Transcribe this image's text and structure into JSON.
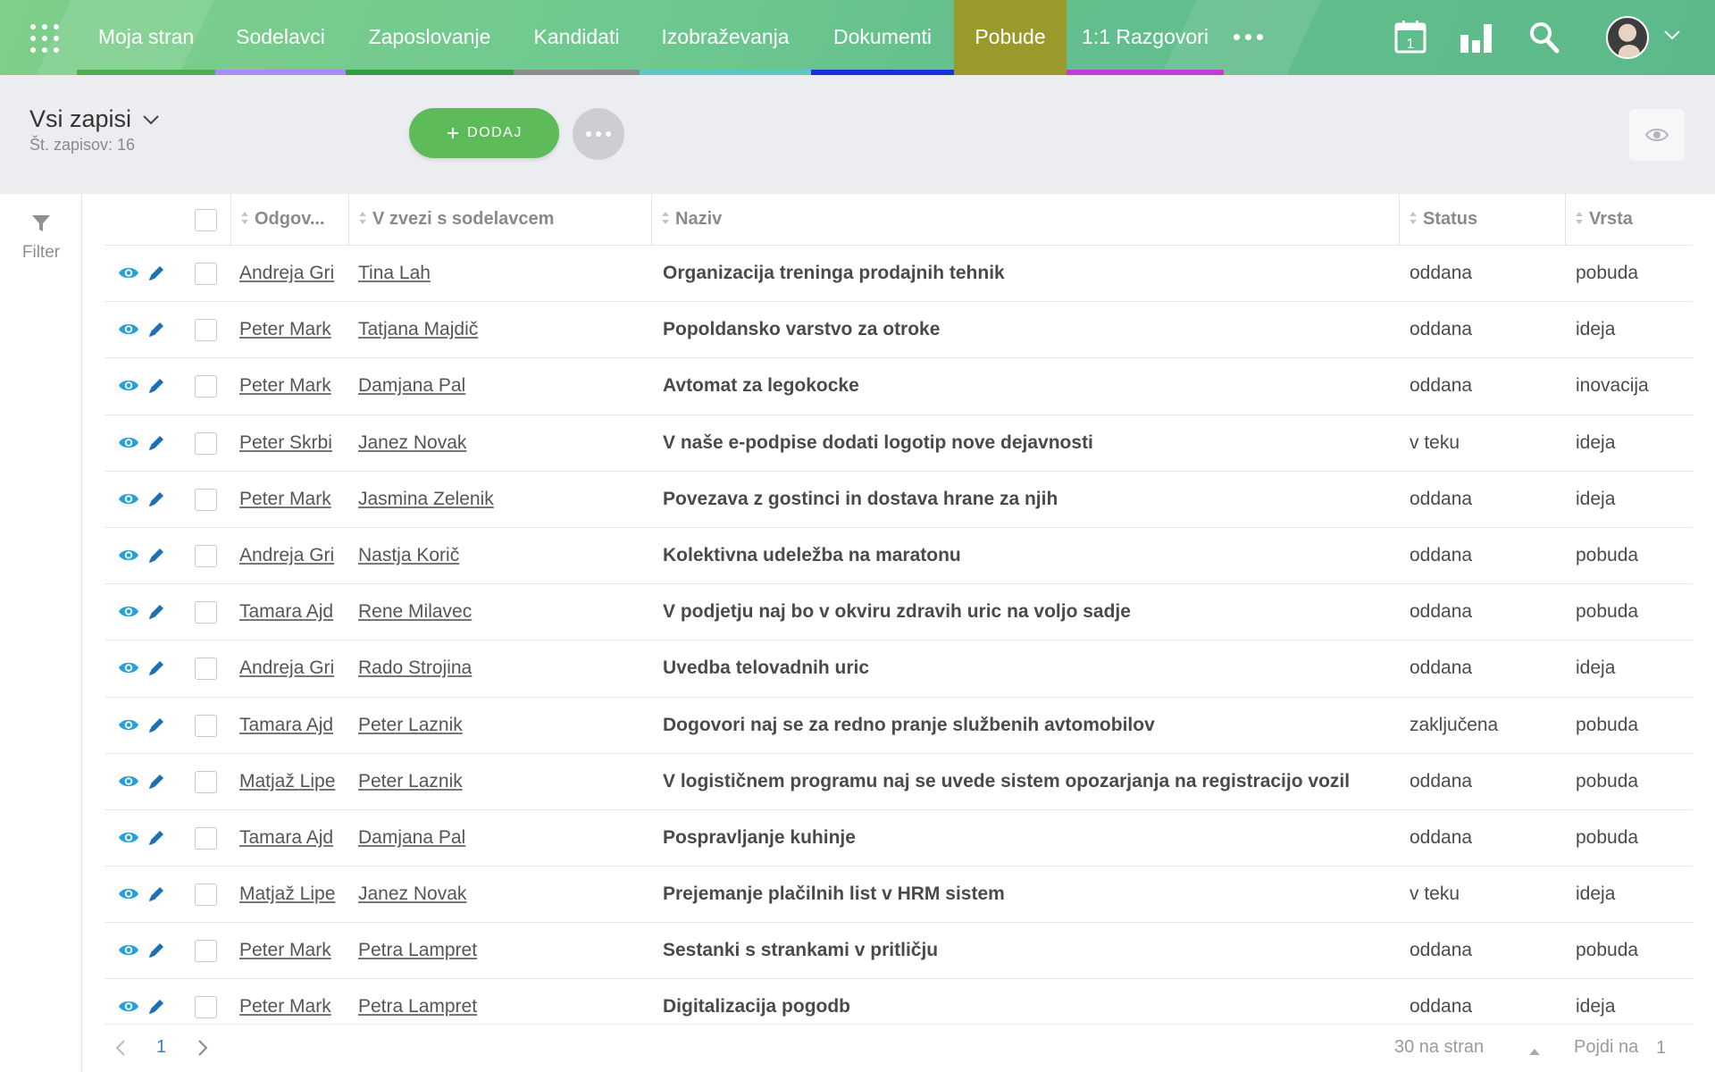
{
  "nav": {
    "items": [
      {
        "label": "Moja stran",
        "color": "#4caf50"
      },
      {
        "label": "Sodelavci",
        "color": "#a78bfa"
      },
      {
        "label": "Zaposlovanje",
        "color": "#2e9e3e"
      },
      {
        "label": "Kandidati",
        "color": "#8c8c8c"
      },
      {
        "label": "Izobraževanja",
        "color": "#5bc8c2"
      },
      {
        "label": "Dokumenti",
        "color": "#1a2fd6"
      },
      {
        "label": "Pobude",
        "color": "#9a9a2c"
      },
      {
        "label": "1:1 Razgovori",
        "color": "#c13bd6"
      }
    ],
    "active": "Pobude",
    "calendar_day": "1",
    "icons": [
      "apps-grid-icon",
      "more-dots-icon",
      "calendar-icon",
      "bar-chart-icon",
      "search-icon",
      "avatar",
      "chevron-down-icon"
    ]
  },
  "toolbar": {
    "view_title": "Vsi zapisi",
    "count_text": "Št. zapisov: 16",
    "add_label": "DODAJ"
  },
  "filter": {
    "label": "Filter"
  },
  "table": {
    "columns": [
      "Odgov...",
      "V zvezi s sodelavcem",
      "Naziv",
      "Status",
      "Vrsta"
    ],
    "rows": [
      {
        "odgovorni": "Andreja Gri",
        "sodelavec": "Tina Lah",
        "naziv": "Organizacija treninga prodajnih tehnik",
        "status": "oddana",
        "vrsta": "pobuda"
      },
      {
        "odgovorni": "Peter Mark",
        "sodelavec": "Tatjana Majdič",
        "naziv": "Popoldansko varstvo za otroke",
        "status": "oddana",
        "vrsta": "ideja"
      },
      {
        "odgovorni": "Peter Mark",
        "sodelavec": "Damjana Pal",
        "naziv": "Avtomat za legokocke",
        "status": "oddana",
        "vrsta": "inovacija"
      },
      {
        "odgovorni": "Peter Skrbi",
        "sodelavec": "Janez Novak",
        "naziv": "V naše e-podpise dodati logotip nove dejavnosti",
        "status": "v teku",
        "vrsta": "ideja"
      },
      {
        "odgovorni": "Peter Mark",
        "sodelavec": "Jasmina Zelenik",
        "naziv": "Povezava z gostinci in dostava hrane za njih",
        "status": "oddana",
        "vrsta": "ideja"
      },
      {
        "odgovorni": "Andreja Gri",
        "sodelavec": "Nastja Korič",
        "naziv": "Kolektivna udeležba na maratonu",
        "status": "oddana",
        "vrsta": "pobuda"
      },
      {
        "odgovorni": "Tamara Ajd",
        "sodelavec": "Rene Milavec",
        "naziv": "V podjetju naj bo v okviru zdravih uric na voljo sadje",
        "status": "oddana",
        "vrsta": "pobuda"
      },
      {
        "odgovorni": "Andreja Gri",
        "sodelavec": "Rado Strojina",
        "naziv": "Uvedba telovadnih uric",
        "status": "oddana",
        "vrsta": "ideja"
      },
      {
        "odgovorni": "Tamara Ajd",
        "sodelavec": "Peter Laznik",
        "naziv": "Dogovori naj se za redno pranje službenih avtomobilov",
        "status": "zaključena",
        "vrsta": "pobuda"
      },
      {
        "odgovorni": "Matjaž Lipe",
        "sodelavec": "Peter Laznik",
        "naziv": "V logističnem programu naj se uvede sistem opozarjanja na registracijo vozil",
        "status": "oddana",
        "vrsta": "pobuda"
      },
      {
        "odgovorni": "Tamara Ajd",
        "sodelavec": "Damjana Pal",
        "naziv": "Pospravljanje kuhinje",
        "status": "oddana",
        "vrsta": "pobuda"
      },
      {
        "odgovorni": "Matjaž Lipe",
        "sodelavec": "Janez Novak",
        "naziv": "Prejemanje plačilnih list v HRM sistem",
        "status": "v teku",
        "vrsta": "ideja"
      },
      {
        "odgovorni": "Peter Mark",
        "sodelavec": "Petra Lampret",
        "naziv": "Sestanki s strankami v pritličju",
        "status": "oddana",
        "vrsta": "pobuda"
      },
      {
        "odgovorni": "Peter Mark",
        "sodelavec": "Petra Lampret",
        "naziv": "Digitalizacija pogodb",
        "status": "oddana",
        "vrsta": "ideja"
      }
    ]
  },
  "pager": {
    "current_page": "1",
    "per_page": "30 na stran",
    "goto_label": "Pojdi na",
    "goto_value": "1"
  },
  "colors": {
    "accent_green": "#5dbb5a",
    "active_tab": "#9a9a2c",
    "icon_blue": "#2a9fd6",
    "link_text": "#555555"
  }
}
